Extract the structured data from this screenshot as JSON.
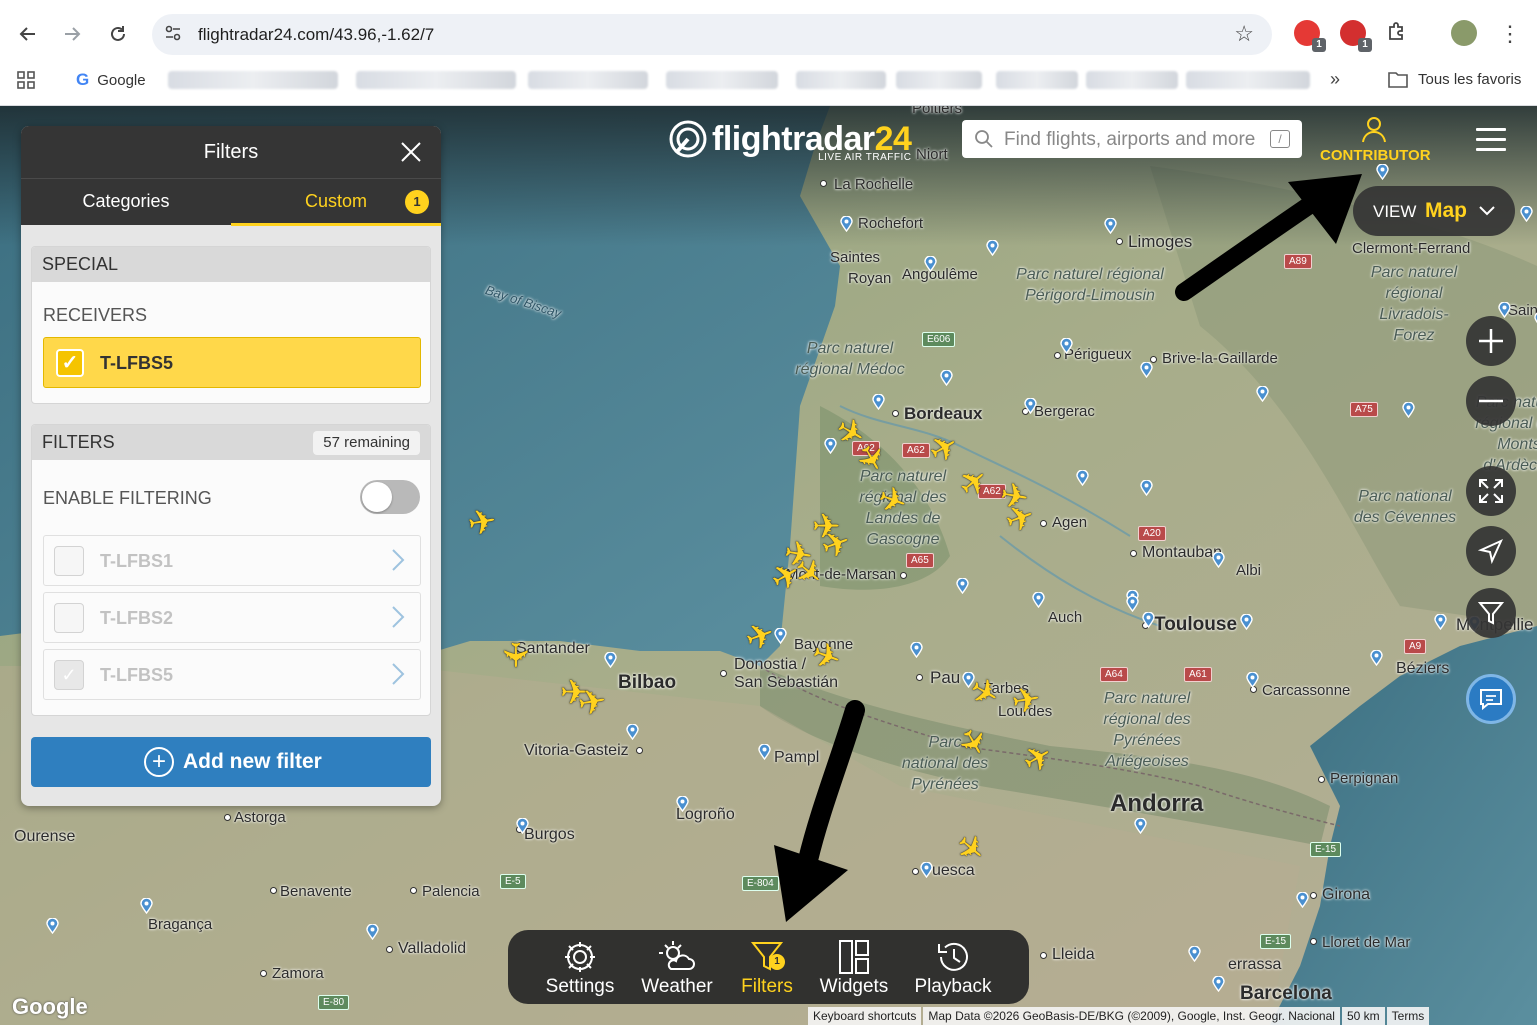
{
  "browser": {
    "url": "flightradar24.com/43.96,-1.62/7",
    "bookmark_google": "Google",
    "bookmark_all": "Tous les favoris",
    "more_chevron": "»",
    "ext_badge_1": "1",
    "ext_badge_2": "1"
  },
  "fr24": {
    "logo_word_a": "flightradar",
    "logo_word_b": "24",
    "logo_sub": "LIVE AIR TRAFFIC",
    "search_placeholder": "Find flights, airports and more",
    "search_shortcut": "/",
    "contributor_label": "CONTRIBUTOR",
    "view_label": "VIEW",
    "view_value": "Map"
  },
  "filters_panel": {
    "title": "Filters",
    "tabs": [
      {
        "label": "Categories"
      },
      {
        "label": "Custom",
        "count": "1"
      }
    ],
    "special_header": "SPECIAL",
    "receivers_label": "RECEIVERS",
    "receiver_selected": "T-LFBS5",
    "filters_header": "FILTERS",
    "remaining": "57 remaining",
    "enable_filtering": "ENABLE FILTERING",
    "filter_items": [
      {
        "label": "T-LFBS1",
        "checked": false
      },
      {
        "label": "T-LFBS2",
        "checked": false
      },
      {
        "label": "T-LFBS5",
        "checked": true
      }
    ],
    "add_button": "Add new filter"
  },
  "bottom_toolbar": {
    "items": [
      {
        "label": "Settings"
      },
      {
        "label": "Weather"
      },
      {
        "label": "Filters",
        "count": "1"
      },
      {
        "label": "Widgets"
      },
      {
        "label": "Playback"
      }
    ]
  },
  "map": {
    "cities": {
      "la_rochelle": "La Rochelle",
      "rochefort": "Rochefort",
      "niort": "Niort",
      "saintes": "Saintes",
      "royan": "Royan",
      "angouleme": "Angoulême",
      "limoges": "Limoges",
      "clermont": "Clermont-Ferrand",
      "perigueux": "Périgueux",
      "brive": "Brive-la-Gaillarde",
      "bordeaux": "Bordeaux",
      "bergerac": "Bergerac",
      "agen": "Agen",
      "montauban": "Montauban",
      "albi": "Albi",
      "mont_de_marsan": "Mont-de-Marsan",
      "toulouse": "Toulouse",
      "auch": "Auch",
      "bayonne": "Bayonne",
      "donostia": "Donostia /",
      "san_sebastian": "San Sebastián",
      "santander": "Santander",
      "bilbao": "Bilbao",
      "vitoria": "Vitoria-Gasteiz",
      "pau": "Pau",
      "tarbes": "Tarbes",
      "lourdes": "Lourdes",
      "pamplona": "Pampl",
      "carcassonne": "Carcassonne",
      "beziers": "Béziers",
      "perpignan": "Perpignan",
      "andorra": "Andorra",
      "logrono": "Logroño",
      "burgos": "Burgos",
      "astorga": "Astorga",
      "ourense": "Ourense",
      "benavente": "Benavente",
      "palencia": "Palencia",
      "braganca": "Bragança",
      "valladolid": "Valladolid",
      "zamora": "Zamora",
      "huesca": "uesca",
      "lleida": "Lleida",
      "girona": "Girona",
      "lloret": "Lloret de Mar",
      "terrassa": "errassa",
      "barcelona": "Barcelona",
      "montpellier": "Montpellie",
      "poitiers": "Poitiers",
      "bay_of_biscay": "Bay of Biscay",
      "sain": "Sain"
    },
    "parks": {
      "perigord": "Parc naturel régional Périgord-Limousin",
      "medoc": "Parc naturel régional Médoc",
      "landes": "Parc naturel régional des Landes de Gascogne",
      "livradois": "Parc naturel régional Livradois-Forez",
      "cevennes": "Parc national des Cévennes",
      "monts": "Parc naturel régional des Monts d'Ardèche",
      "ariege": "Parc naturel régional des Pyrénées Ariégeoises",
      "pyrenees": "Parc national des Pyrénées"
    },
    "roads": {
      "e606": "E606",
      "a89": "A89",
      "a62a": "A62",
      "a62b": "A62",
      "a62c": "A62",
      "a65": "A65",
      "a20": "A20",
      "a75": "A75",
      "a64": "A64",
      "a61": "A61",
      "a9": "A9",
      "e15": "E-15",
      "e15b": "E-15",
      "e5": "E-5",
      "e804": "E-804",
      "e80": "E-80"
    },
    "attribution": {
      "shortcuts": "Keyboard shortcuts",
      "data": "Map Data ©2026 GeoBasis-DE/BKG (©2009), Google, Inst. Geogr. Nacional",
      "scale": "50 km",
      "terms": "Terms"
    },
    "google_logo": "Google"
  },
  "colors": {
    "accent": "#ffd21e",
    "panel_dark": "#353535",
    "button_blue": "#2f7fbf",
    "sea": "#4e7f90",
    "land": "#a5ae8e"
  }
}
